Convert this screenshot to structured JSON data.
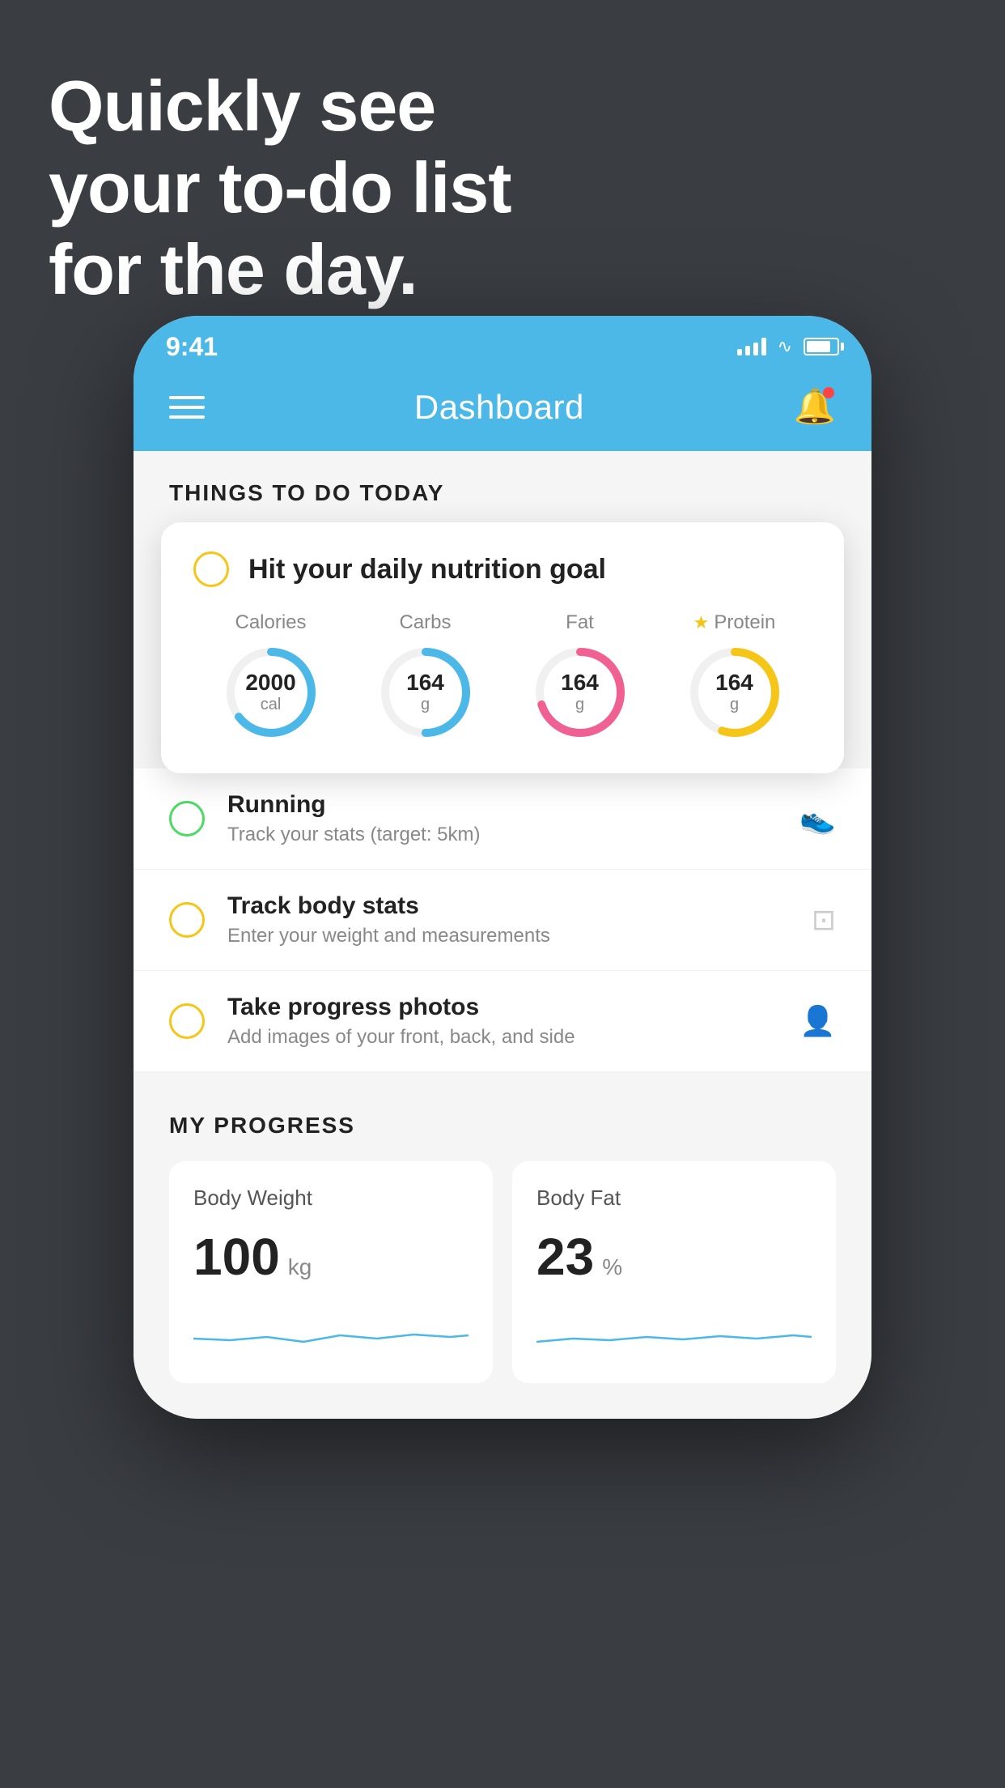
{
  "hero": {
    "line1": "Quickly see",
    "line2": "your to-do list",
    "line3": "for the day."
  },
  "status_bar": {
    "time": "9:41"
  },
  "header": {
    "title": "Dashboard"
  },
  "things_section": {
    "section_label": "THINGS TO DO TODAY"
  },
  "nutrition_card": {
    "checkbox_label": "",
    "title": "Hit your daily nutrition goal",
    "nutrients": [
      {
        "label": "Calories",
        "value": "2000",
        "unit": "cal",
        "color": "blue",
        "starred": false,
        "percent": 65
      },
      {
        "label": "Carbs",
        "value": "164",
        "unit": "g",
        "color": "blue",
        "starred": false,
        "percent": 50
      },
      {
        "label": "Fat",
        "value": "164",
        "unit": "g",
        "color": "pink",
        "starred": false,
        "percent": 70
      },
      {
        "label": "Protein",
        "value": "164",
        "unit": "g",
        "color": "yellow",
        "starred": true,
        "percent": 55
      }
    ]
  },
  "todo_items": [
    {
      "name": "Running",
      "desc": "Track your stats (target: 5km)",
      "circle_color": "green",
      "icon": "👟"
    },
    {
      "name": "Track body stats",
      "desc": "Enter your weight and measurements",
      "circle_color": "yellow",
      "icon": "⚖️"
    },
    {
      "name": "Take progress photos",
      "desc": "Add images of your front, back, and side",
      "circle_color": "yellow",
      "icon": "👤"
    }
  ],
  "progress_section": {
    "label": "MY PROGRESS",
    "cards": [
      {
        "title": "Body Weight",
        "value": "100",
        "unit": "kg"
      },
      {
        "title": "Body Fat",
        "value": "23",
        "unit": "%"
      }
    ]
  }
}
